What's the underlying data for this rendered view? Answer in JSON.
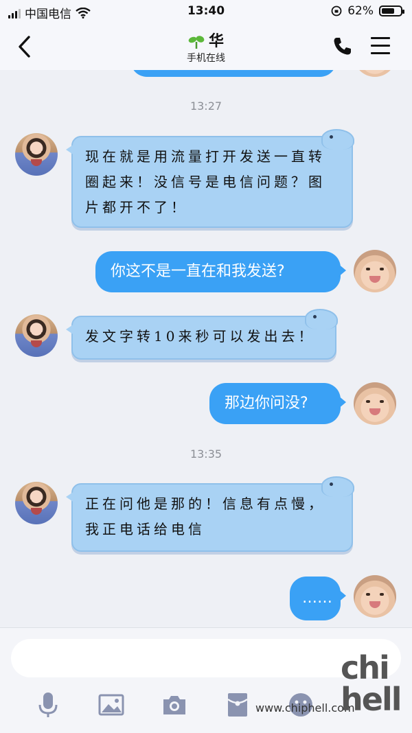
{
  "status_bar": {
    "carrier": "中国电信",
    "time": "13:40",
    "battery": "62%"
  },
  "nav": {
    "title": "华",
    "subtitle": "手机在线"
  },
  "chat": {
    "timestamps": [
      "13:27",
      "13:35"
    ],
    "messages": [
      {
        "side": "incoming",
        "text": "现在就是用流量打开发送一直转圈起来！没信号是电信问题？图片都开不了！"
      },
      {
        "side": "outgoing",
        "text": "你这不是一直在和我发送?"
      },
      {
        "side": "incoming",
        "text": "发文字转10来秒可以发出去！"
      },
      {
        "side": "outgoing",
        "text": "那边你问没?"
      },
      {
        "side": "incoming",
        "text": "正在问他是那的！信息有点慢，我正电话给电信"
      },
      {
        "side": "outgoing",
        "text": "……"
      }
    ]
  },
  "input": {
    "placeholder": ""
  },
  "toolbar": {
    "icons": [
      "microphone-icon",
      "image-icon",
      "camera-icon",
      "red-packet-icon",
      "emoji-icon"
    ]
  },
  "watermark": {
    "url": "www.chiphell.com",
    "logo": "chiphell"
  },
  "colors": {
    "incoming_bubble": "#a9d2f4",
    "outgoing_bubble": "#3aa1f5",
    "background": "#eef0f5"
  }
}
